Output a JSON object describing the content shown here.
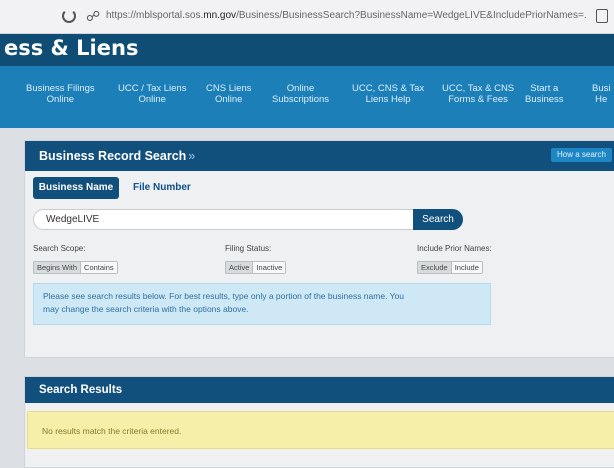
{
  "browser": {
    "url_prefix": "https://mblsportal.sos.",
    "url_domain": "mn.gov",
    "url_rest": "/Business/BusinessSearch?BusinessName=WedgeLIVE&IncludePriorNames=..."
  },
  "header": {
    "title": "ess & Liens"
  },
  "nav": {
    "items": [
      {
        "line1": "Business Filings",
        "line2": "Online"
      },
      {
        "line1": "UCC / Tax Liens",
        "line2": "Online"
      },
      {
        "line1": "CNS Liens",
        "line2": "Online"
      },
      {
        "line1": "Online",
        "line2": "Subscriptions"
      },
      {
        "line1": "UCC, CNS & Tax",
        "line2": "Liens Help"
      },
      {
        "line1": "UCC, Tax & CNS",
        "line2": "Forms & Fees"
      },
      {
        "line1": "Start a",
        "line2": "Business"
      },
      {
        "line1": "Busi",
        "line2": "He"
      }
    ]
  },
  "search_panel": {
    "title": "Business Record Search",
    "arrow": "»",
    "how_button": "How a search",
    "tab_active": "Business Name",
    "tab_other": "File Number",
    "input_value": "WedgeLIVE",
    "search_button": "Search",
    "scope_label": "Search Scope:",
    "scope_options": [
      "Begins With",
      "Contains"
    ],
    "status_label": "Filing Status:",
    "status_options": [
      "Active",
      "Inactive"
    ],
    "prior_label": "Include Prior Names:",
    "prior_options": [
      "Exclude",
      "Include"
    ],
    "info_line1": "Please see search results below. For best results, type only a portion of the business name. You",
    "info_line2": "may change the search criteria with the options above."
  },
  "results": {
    "title": "Search Results",
    "message": "No results match the criteria entered."
  },
  "colors": {
    "header_dark": "#0f4d75",
    "nav_blue": "#1c7fb7",
    "panel_head": "#114f7c",
    "info_bg": "#cfe8f6",
    "no_results_bg": "#f5efaa"
  }
}
